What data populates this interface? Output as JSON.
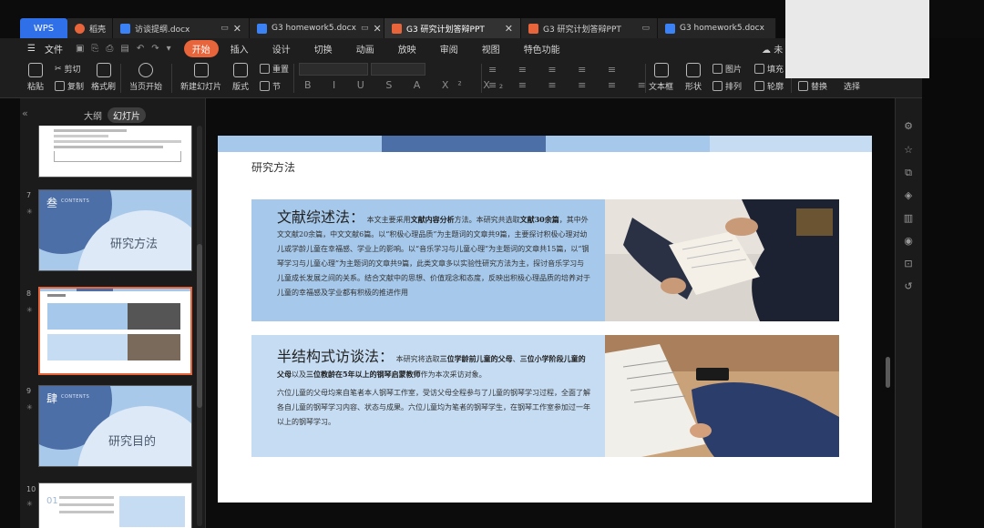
{
  "tabs": {
    "wps": "WPS",
    "items": [
      {
        "label": "稻壳",
        "icon": "daoke-icon",
        "kind": "dao"
      },
      {
        "label": "访谈提纲.docx",
        "icon": "docx-icon",
        "kind": "doc"
      },
      {
        "label": "G3 homework5.docx",
        "icon": "docx-icon",
        "kind": "doc"
      },
      {
        "label": "G3 研究计划答辩PPT",
        "icon": "ppt-icon",
        "kind": "ppt",
        "active": true
      },
      {
        "label": "G3 研究计划答辩PPT",
        "icon": "ppt-icon",
        "kind": "ppt"
      },
      {
        "label": "G3 homework5.docx",
        "icon": "docx-icon",
        "kind": "doc"
      }
    ]
  },
  "menubar": {
    "file": "文件",
    "tabs": [
      "开始",
      "插入",
      "设计",
      "切换",
      "动画",
      "放映",
      "审阅",
      "视图",
      "特色功能"
    ],
    "active_tab": "开始",
    "cloud_label": "未"
  },
  "ribbon": {
    "paste": "粘贴",
    "cut": "剪切",
    "copy": "复制",
    "format_painter": "格式刷",
    "play_from_current": "当页开始",
    "new_slide": "新建幻灯片",
    "layout": "版式",
    "reset": "重置",
    "section": "节",
    "textbox": "文本框",
    "shape": "形状",
    "picture": "图片",
    "arrange": "排列",
    "fill": "填充",
    "outline": "轮廓",
    "replace": "替换",
    "select": "选择",
    "format_glyphs": "B I U S A X² X₂"
  },
  "left_panel": {
    "tab_outline": "大纲",
    "tab_slides": "幻灯片",
    "thumbs": [
      {
        "num": "7",
        "title": "研究方法",
        "section_num": "叁",
        "contents": "CONTENTS"
      },
      {
        "num": "8"
      },
      {
        "num": "9",
        "title": "研究目的",
        "section_num": "肆",
        "contents": "CONTENTS"
      },
      {
        "num": "10",
        "intro_num": "01"
      }
    ]
  },
  "slide": {
    "title": "研究方法",
    "colors": {
      "band1": "#a6c8ea",
      "band2": "#4d6fa7",
      "band3": "#a6c8ea",
      "band4": "#c5dcf3"
    },
    "block1": {
      "heading": "文献综述法",
      "colon": "：",
      "p1": "本文主要采用",
      "b1": "文献内容分析",
      "p2": "方法。本研究共选取",
      "b2": "文献30余篇",
      "p3": "，其中外文文献20余篇，中文文献6篇。以“积极心理品质”为主题词的文章共9篇，主要探讨积极心理对幼儿或学龄儿童在幸福感、学业上的影响。以“音乐学习与儿童心理”为主题词的文章共15篇，以“钢琴学习与儿童心理”为主题词的文章共9篇，此类文章多以实验性研究方法为主，探讨音乐学习与儿童成长发展之间的关系。结合文献中的思想、价值观念和态度，反映出积极心理品质的培养对于儿童的幸福感及学业都有积极的推进作用"
    },
    "block2": {
      "heading": "半结构式访谈法",
      "colon": "：",
      "p1": "本研究将选取",
      "b1": "三位学龄前儿童的父母",
      "p2": "、",
      "b2": "三位小学阶段儿童的父母",
      "p3": "以及",
      "b3": "三位教龄在5年以上的钢琴启蒙教师",
      "p4": "作为本次采访对象。",
      "para2": "六位儿童的父母均来自笔者本人钢琴工作室，受访父母全程参与了儿童的钢琴学习过程，全面了解各自儿童的钢琴学习内容、状态与成果。六位儿童均为笔者的钢琴学生，在钢琴工作室参加过一年以上的钢琴学习。"
    }
  },
  "right_bar": {
    "icons": [
      "settings-sliders-icon",
      "star-icon",
      "copy-icon",
      "layers-icon",
      "chart-icon",
      "compass-icon",
      "image-settings-icon",
      "history-icon"
    ]
  }
}
